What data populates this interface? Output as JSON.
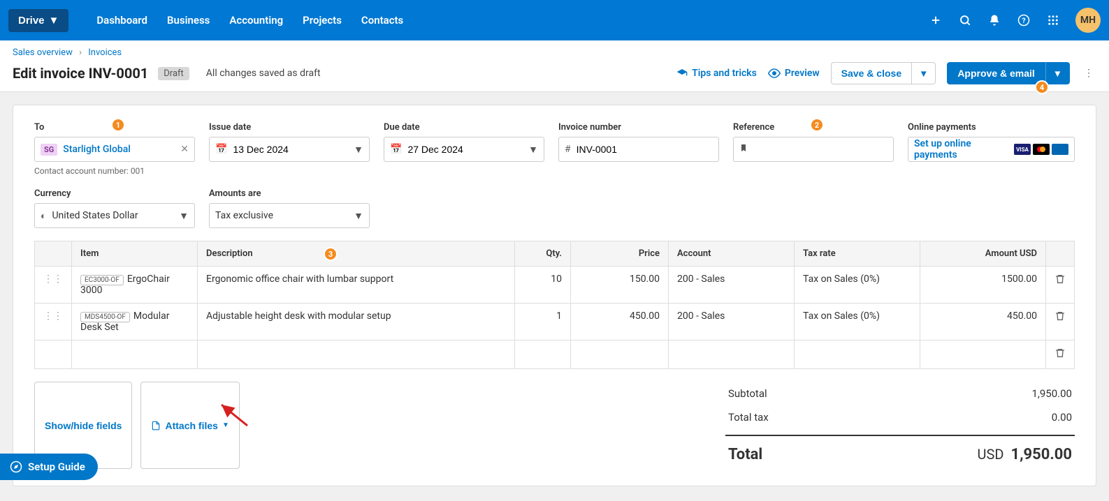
{
  "nav": {
    "drive": "Drive",
    "items": [
      "Dashboard",
      "Business",
      "Accounting",
      "Projects",
      "Contacts"
    ],
    "avatar": "MH"
  },
  "breadcrumb": {
    "a": "Sales overview",
    "b": "Invoices"
  },
  "header": {
    "title": "Edit invoice INV-0001",
    "badge": "Draft",
    "status": "All changes saved as draft",
    "tips": "Tips and tricks",
    "preview": "Preview",
    "save_close": "Save & close",
    "approve_email": "Approve & email"
  },
  "fields": {
    "to_label": "To",
    "to_chip": "SG",
    "to_name": "Starlight Global",
    "to_sub": "Contact account number: 001",
    "issue_label": "Issue date",
    "issue_value": "13 Dec 2024",
    "due_label": "Due date",
    "due_value": "27 Dec 2024",
    "invno_label": "Invoice number",
    "invno_value": "INV-0001",
    "ref_label": "Reference",
    "ref_value": "",
    "pay_label": "Online payments",
    "pay_link": "Set up online payments",
    "currency_label": "Currency",
    "currency_value": "United States Dollar",
    "amounts_label": "Amounts are",
    "amounts_value": "Tax exclusive"
  },
  "table": {
    "headers": {
      "item": "Item",
      "desc": "Description",
      "qty": "Qty.",
      "price": "Price",
      "account": "Account",
      "tax": "Tax rate",
      "amount": "Amount USD"
    },
    "rows": [
      {
        "sku": "EC3000-OF",
        "name": "ErgoChair 3000",
        "desc": "Ergonomic office chair with lumbar support",
        "qty": "10",
        "price": "150.00",
        "account": "200 - Sales",
        "tax": "Tax on Sales (0%)",
        "amount": "1500.00"
      },
      {
        "sku": "MDS4500-OF",
        "name": "Modular Desk Set",
        "desc": "Adjustable height desk with modular setup",
        "qty": "1",
        "price": "450.00",
        "account": "200 - Sales",
        "tax": "Tax on Sales (0%)",
        "amount": "450.00"
      }
    ]
  },
  "actions": {
    "showhide": "Show/hide fields",
    "attach": "Attach files"
  },
  "totals": {
    "subtotal_label": "Subtotal",
    "subtotal": "1,950.00",
    "tax_label": "Total tax",
    "tax": "0.00",
    "total_label": "Total",
    "currency": "USD",
    "total": "1,950.00"
  },
  "setup_guide": "Setup Guide",
  "hints": {
    "h1": "1",
    "h2": "2",
    "h3": "3",
    "h4": "4"
  }
}
